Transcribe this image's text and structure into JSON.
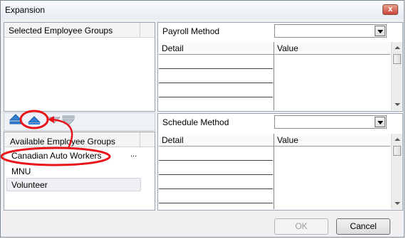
{
  "window": {
    "title": "Expansion",
    "close_glyph": "x"
  },
  "left": {
    "selected_header": "Selected Employee Groups",
    "available_header": "Available Employee Groups",
    "available_items": [
      "Canadian Auto Workers",
      "MNU",
      "Volunteer"
    ],
    "ellipsis": "...",
    "toolbar_icons": [
      "move-top-icon",
      "move-up-icon",
      "move-down-icon",
      "move-bottom-icon"
    ]
  },
  "payroll": {
    "label": "Payroll Method",
    "selected": "",
    "col_detail": "Detail",
    "col_value": "Value"
  },
  "schedule": {
    "label": "Schedule Method",
    "selected": "",
    "col_detail": "Detail",
    "col_value": "Value"
  },
  "buttons": {
    "ok": "OK",
    "cancel": "Cancel"
  },
  "annotation_color": "#e8141c"
}
